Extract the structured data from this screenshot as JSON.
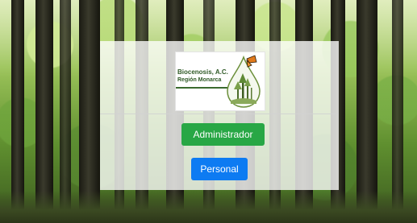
{
  "logo": {
    "name": "Biocenosis, A.C.",
    "region": "Región Monarca"
  },
  "buttons": {
    "admin_label": "Administrador",
    "personal_label": "Personal"
  },
  "colors": {
    "admin": "#28a745",
    "personal": "#0d7bf2",
    "brand_green": "#2f5a26"
  }
}
